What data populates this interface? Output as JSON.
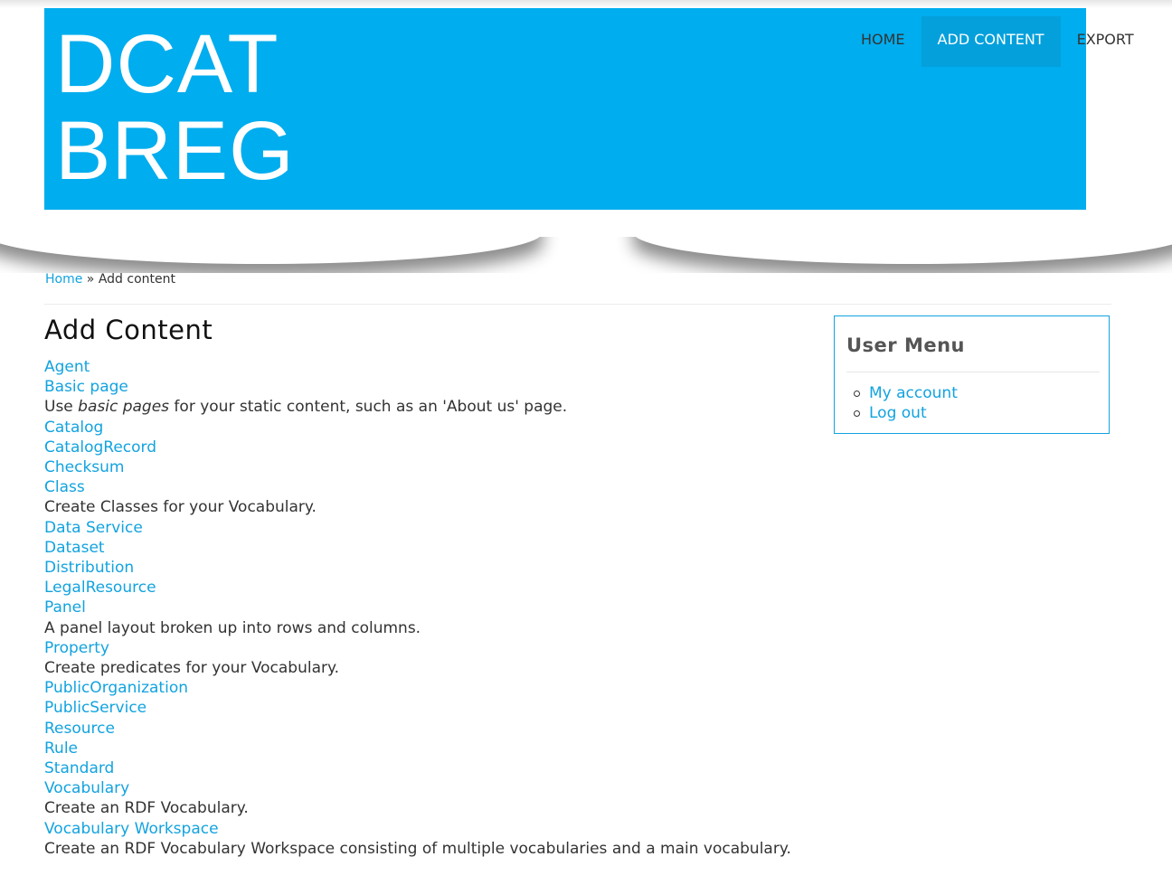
{
  "site": {
    "name_line1": "DCAT",
    "name_line2": "BREG"
  },
  "nav": {
    "items": [
      {
        "label": "HOME"
      },
      {
        "label": "ADD CONTENT",
        "active": true
      },
      {
        "label": "EXPORT"
      }
    ]
  },
  "breadcrumb": {
    "home": "Home",
    "separator": " » ",
    "current": "Add content"
  },
  "page": {
    "title": "Add Content"
  },
  "content_types": [
    {
      "label": "Agent"
    },
    {
      "label": "Basic page",
      "desc_parts": [
        "Use ",
        "basic pages",
        " for your static content, such as an 'About us' page."
      ]
    },
    {
      "label": "Catalog"
    },
    {
      "label": "CatalogRecord"
    },
    {
      "label": "Checksum"
    },
    {
      "label": "Class",
      "desc": "Create Classes for your Vocabulary."
    },
    {
      "label": "Data Service"
    },
    {
      "label": "Dataset"
    },
    {
      "label": "Distribution"
    },
    {
      "label": "LegalResource"
    },
    {
      "label": "Panel",
      "desc": "A panel layout broken up into rows and columns."
    },
    {
      "label": "Property",
      "desc": "Create predicates for your Vocabulary."
    },
    {
      "label": "PublicOrganization"
    },
    {
      "label": "PublicService"
    },
    {
      "label": "Resource"
    },
    {
      "label": "Rule"
    },
    {
      "label": "Standard"
    },
    {
      "label": "Vocabulary",
      "desc": "Create an RDF Vocabulary."
    },
    {
      "label": "Vocabulary Workspace",
      "desc": "Create an RDF Vocabulary Workspace consisting of multiple vocabularies and a main vocabulary."
    }
  ],
  "user_menu": {
    "title": "User Menu",
    "items": [
      {
        "label": "My account"
      },
      {
        "label": "Log out"
      }
    ]
  },
  "colors": {
    "brand": "#00adee",
    "link": "#12a3df",
    "nav_active": "#03a0dc"
  }
}
